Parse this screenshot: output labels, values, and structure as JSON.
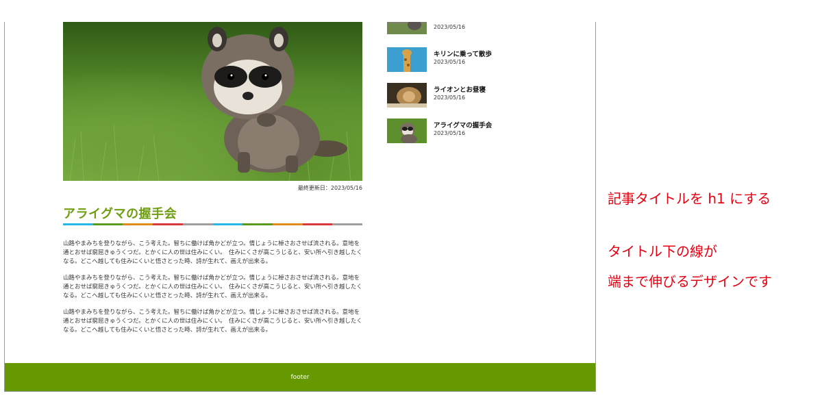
{
  "article": {
    "updated": "最終更新日：2023/05/16",
    "title": "アライグマの握手会",
    "title_line_colors": [
      "#29b6e6",
      "#5a9a1b",
      "#e08a1e",
      "#d9383a",
      "#9e9e9e",
      "#29b6e6",
      "#5a9a1b",
      "#e08a1e",
      "#d9383a",
      "#9e9e9e"
    ],
    "paragraphs": [
      "山路やまみちを登りながら、こう考えた。智ちに働けば角かどが立つ。情じょうに棹さおさせば流される。意地を通とおせば窮屈きゅうくつだ。とかくに人の世は住みにくい。　住みにくさが高こうじると、安い所へ引き越したくなる。どこへ越しても住みにくいと悟さとった時、詩が生れて、画えが出来る。",
      "山路やまみちを登りながら、こう考えた。智ちに働けば角かどが立つ。情じょうに棹さおさせば流される。意地を通とおせば窮屈きゅうくつだ。とかくに人の世は住みにくい。　住みにくさが高こうじると、安い所へ引き越したくなる。どこへ越しても住みにくいと悟さとった時、詩が生れて、画えが出来る。",
      "山路やまみちを登りながら、こう考えた。智ちに働けば角かどが立つ。情じょうに棹さおさせば流される。意地を通とおせば窮屈きゅうくつだ。とかくに人の世は住みにくい。　住みにくさが高こうじると、安い所へ引き越したくなる。どこへ越しても住みにくいと悟さとった時、詩が生れて、画えが出来る。"
    ]
  },
  "sidebar": {
    "items": [
      {
        "title": "",
        "date": "2023/05/16",
        "thumb": "animal"
      },
      {
        "title": "キリンに乗って散歩",
        "date": "2023/05/16",
        "thumb": "giraffe"
      },
      {
        "title": "ライオンとお昼寝",
        "date": "2023/05/16",
        "thumb": "lion"
      },
      {
        "title": "アライグマの握手会",
        "date": "2023/05/16",
        "thumb": "raccoon"
      }
    ]
  },
  "footer": {
    "label": "footer"
  },
  "annotations": {
    "line1": "記事タイトルを h1 にする",
    "line2": "タイトル下の線が",
    "line3": "端まで伸びるデザインです"
  },
  "colors": {
    "accent_green": "#669900",
    "title_green": "#6f9e12",
    "annotation_red": "#e60012"
  }
}
